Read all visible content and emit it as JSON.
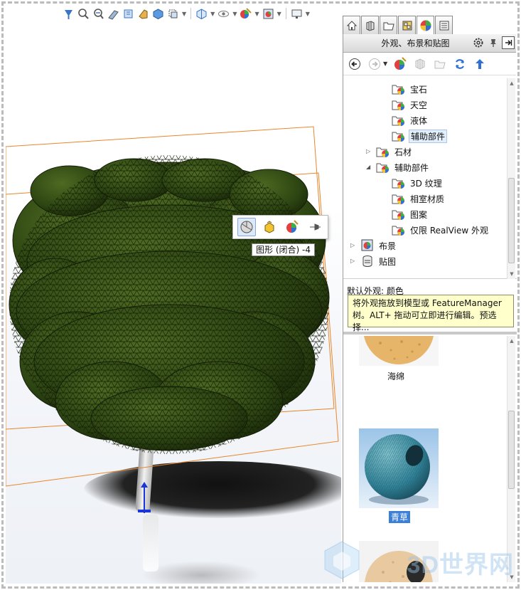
{
  "window": {
    "frame": "dashed"
  },
  "viewport": {
    "heads_up_toolbar": {
      "icons": [
        "zoom-to-fit-icon",
        "zoom-area-icon",
        "previous-view-icon",
        "section-view-icon",
        "dynamic-annotation-icon",
        "view-orientation-icon",
        "display-style-icon",
        "hide-show-icon",
        "edit-appearance-icon",
        "apply-scene-icon",
        "view-settings-icon"
      ]
    },
    "context_toolbar": {
      "buttons": [
        "appearance-face-icon",
        "appearance-body-icon",
        "appearance-part-icon",
        "pin-icon"
      ],
      "tooltip": "图形 (闭合) -4"
    },
    "colors": {
      "bounding_box": "#e8862a",
      "foliage": "#2f4a14",
      "axis": "#1a36d8",
      "annotation_circle": "#d91c1c"
    }
  },
  "task_pane": {
    "tabs": [
      "home-icon",
      "design-library-icon",
      "file-explorer-icon",
      "view-palette-icon",
      "appearances-icon",
      "custom-properties-icon"
    ],
    "active_tab": "appearances-icon",
    "title": "外观、布景和贴图",
    "header_icons": [
      "gear-icon",
      "pin-icon",
      "collapse-icon"
    ],
    "toolbar_icons": [
      "back-icon",
      "forward-icon",
      "appearance-icon",
      "3d-box-icon",
      "folder-icon",
      "refresh-icon",
      "up-icon"
    ],
    "tree": [
      {
        "label": "宝石",
        "level": 2,
        "type": "folder"
      },
      {
        "label": "天空",
        "level": 2,
        "type": "folder"
      },
      {
        "label": "液体",
        "level": 2,
        "type": "folder"
      },
      {
        "label": "辅助部件",
        "level": 2,
        "type": "folder",
        "selected": true
      },
      {
        "label": "石材",
        "level": 1,
        "type": "folder",
        "expander": "collapsed"
      },
      {
        "label": "辅助部件",
        "level": 1,
        "type": "folder",
        "expander": "expanded"
      },
      {
        "label": "3D 纹理",
        "level": 2,
        "type": "folder"
      },
      {
        "label": "相室材质",
        "level": 2,
        "type": "folder"
      },
      {
        "label": "图案",
        "level": 2,
        "type": "folder"
      },
      {
        "label": "仅限 RealView 外观",
        "level": 2,
        "type": "folder"
      },
      {
        "label": "布景",
        "level": 0,
        "type": "scene",
        "expander": "collapsed"
      },
      {
        "label": "贴图",
        "level": 0,
        "type": "decal",
        "expander": "collapsed"
      }
    ],
    "default_appearance_label": "默认外观: 颜色",
    "hint": "将外观拖放到模型或 FeatureManager 树。ALT+ 拖动可立即进行编辑。预选择...",
    "gallery": [
      {
        "label": "海绵",
        "color": "#e6b56a"
      },
      {
        "label": "青草",
        "color": "#3d8fa6",
        "selected": true
      },
      {
        "label": "",
        "color": "#e8c9a0"
      }
    ]
  },
  "watermark": {
    "text": "3D世界网"
  }
}
